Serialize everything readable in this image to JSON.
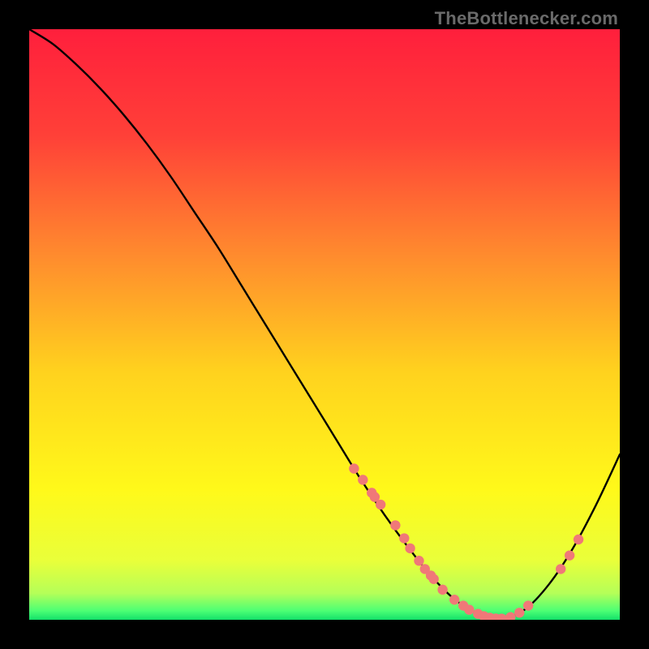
{
  "watermark": "TheBottlenecker.com",
  "chart_data": {
    "type": "line",
    "title": "",
    "xlabel": "",
    "ylabel": "",
    "xlim": [
      0,
      100
    ],
    "ylim": [
      0,
      100
    ],
    "grid": false,
    "legend": false,
    "background_gradient": {
      "stops": [
        {
          "offset": 0.0,
          "color": "#ff1f3c"
        },
        {
          "offset": 0.18,
          "color": "#ff4038"
        },
        {
          "offset": 0.38,
          "color": "#ff8a2e"
        },
        {
          "offset": 0.58,
          "color": "#ffd21e"
        },
        {
          "offset": 0.78,
          "color": "#fff91a"
        },
        {
          "offset": 0.9,
          "color": "#e9ff3a"
        },
        {
          "offset": 0.955,
          "color": "#b5ff58"
        },
        {
          "offset": 0.985,
          "color": "#4cff74"
        },
        {
          "offset": 1.0,
          "color": "#13e06a"
        }
      ]
    },
    "series": [
      {
        "name": "bottleneck-curve",
        "x": [
          0,
          4,
          8,
          12,
          16,
          20,
          24,
          28,
          32,
          36,
          40,
          44,
          48,
          52,
          56,
          60,
          64,
          68,
          72,
          76,
          80,
          84,
          88,
          92,
          96,
          100
        ],
        "y": [
          100,
          97.5,
          94,
          90,
          85.5,
          80.5,
          75,
          69,
          63,
          56.5,
          50,
          43.5,
          37,
          30.5,
          24,
          18,
          12.5,
          7.5,
          3.5,
          1,
          0.2,
          1.8,
          6,
          12,
          19.5,
          28
        ]
      }
    ],
    "scatter_points": {
      "name": "highlighted-points",
      "color": "#f07878",
      "radius": 6.2,
      "x": [
        55,
        56.5,
        58,
        58.5,
        59.5,
        62,
        63.5,
        64.5,
        66,
        67,
        68,
        68.5,
        70,
        72,
        73.5,
        74.5,
        76,
        77,
        78,
        79,
        80,
        81.5,
        83,
        84.5,
        90,
        91.5,
        93
      ],
      "y": [
        25.6,
        23.7,
        21.5,
        20.8,
        19.5,
        16.0,
        13.8,
        12.1,
        10.0,
        8.6,
        7.5,
        6.9,
        5.1,
        3.4,
        2.4,
        1.7,
        1.0,
        0.6,
        0.35,
        0.22,
        0.2,
        0.45,
        1.2,
        2.4,
        8.6,
        10.9,
        13.6
      ]
    }
  }
}
